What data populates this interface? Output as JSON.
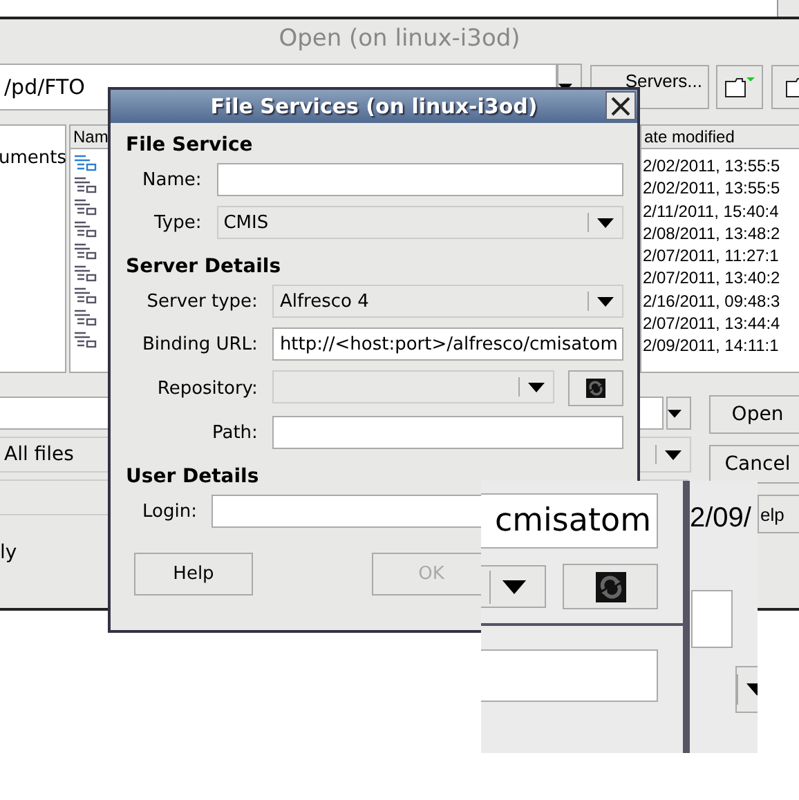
{
  "open_window": {
    "title": "Open (on linux-i3od)",
    "path": "/pd/FTO",
    "servers_button": "Servers...",
    "places": [
      "uments"
    ],
    "name_header": "Nam",
    "files": [
      {
        "selected": true
      },
      {
        "selected": false
      },
      {
        "selected": false
      },
      {
        "selected": false
      },
      {
        "selected": false
      },
      {
        "selected": false
      },
      {
        "selected": false
      },
      {
        "selected": false
      },
      {
        "selected": false
      }
    ],
    "date_header": "ate modified",
    "dates": [
      "2/02/2011, 13:55:5",
      "2/02/2011, 13:55:5",
      "2/11/2011, 15:40:4",
      "2/08/2011, 13:48:2",
      "2/07/2011, 11:27:1",
      "2/07/2011, 13:40:2",
      "2/16/2011, 09:48:3",
      "2/07/2011, 13:44:4",
      "2/09/2011, 14:11:1"
    ],
    "open_button": "Open",
    "cancel_button": "Cancel",
    "filter": "All files",
    "option_text": "ly",
    "help_button": "elp"
  },
  "dialog": {
    "title": "File Services (on linux-i3od)",
    "sections": [
      {
        "heading": "File Service",
        "rows": [
          {
            "kind": "text",
            "label": "Name:"
          },
          {
            "kind": "combo",
            "label": "Type:",
            "value": "CMIS"
          }
        ]
      },
      {
        "heading": "Server Details",
        "rows": [
          {
            "kind": "combo",
            "label": "Server type:",
            "value": "Alfresco 4"
          },
          {
            "kind": "text",
            "label": "Binding URL:",
            "value": "http://<host:port>/alfresco/cmisatom"
          },
          {
            "kind": "combo_refresh",
            "label": "Repository:"
          },
          {
            "kind": "text",
            "label": "Path:"
          }
        ]
      },
      {
        "heading": "User Details",
        "rows": [
          {
            "kind": "text",
            "label": "Login:"
          }
        ]
      }
    ],
    "help_button": {
      "label": "Help",
      "disabled": false
    },
    "ok_button": {
      "label": "OK",
      "disabled": true
    }
  },
  "magnifier": {
    "url_tail": "cmisatom",
    "date_fragment": "2/09/"
  }
}
